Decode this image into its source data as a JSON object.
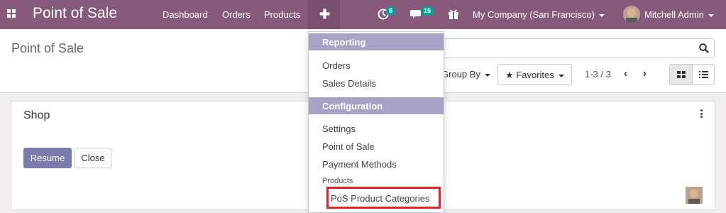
{
  "navbar": {
    "brand": "Point of Sale",
    "items": [
      "Dashboard",
      "Orders",
      "Products"
    ],
    "plus_symbol": "✚",
    "activity_count": "8",
    "message_count": "15",
    "company": "My Company (San Francisco)",
    "user": "Mitchell Admin",
    "color": "#875a7b",
    "accent_color": "#00a09d"
  },
  "control": {
    "title": "Point of Sale",
    "group_by": "Group By",
    "favorites": "Favorites",
    "pager": "1-3 / 3"
  },
  "card": {
    "shop_name": "Shop",
    "resume": "Resume",
    "close": "Close",
    "resume_color": "#7c7bad"
  },
  "menu": {
    "reporting_header": "Reporting",
    "reporting_items": [
      "Orders",
      "Sales Details"
    ],
    "configuration_header": "Configuration",
    "configuration_items": [
      "Settings",
      "Point of Sale",
      "Payment Methods"
    ],
    "products_subheader": "Products",
    "products_items": [
      "PoS Product Categories"
    ],
    "header_color": "#a8a3c4",
    "highlight_color": "#e0232a"
  }
}
